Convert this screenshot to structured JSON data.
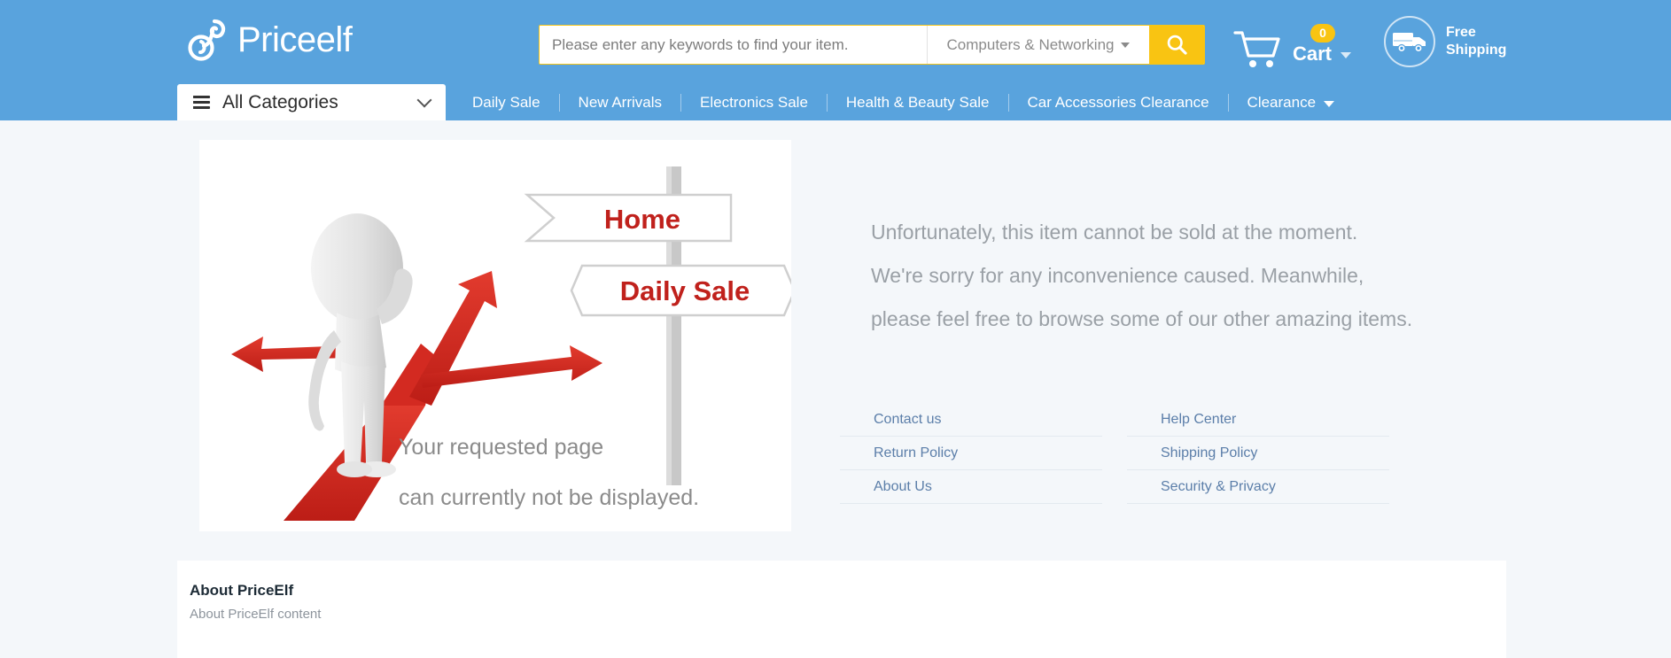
{
  "brand": {
    "name": "Priceelf",
    "logo_icon": "elf-swirl-logo-icon",
    "header_color": "#59a3dd",
    "accent_color": "#f9c412",
    "page_background": "#f4f7fa"
  },
  "search": {
    "placeholder": "Please enter any keywords to find your item.",
    "value": "",
    "category_selected": "Computers & Networking",
    "category_caret_icon": "caret-down-icon",
    "button_icon": "search-icon"
  },
  "cart": {
    "icon": "shopping-cart-icon",
    "badge_count": "0",
    "label": "Cart",
    "caret_icon": "caret-down-icon"
  },
  "shipping": {
    "icon": "delivery-truck-icon",
    "line1": "Free",
    "line2": "Shipping"
  },
  "nav": {
    "all_categories": {
      "label": "All Categories",
      "menu_icon": "list-menu-icon",
      "chevron_icon": "chevron-down-icon"
    },
    "items": [
      {
        "label": "Daily Sale",
        "has_caret": false
      },
      {
        "label": "New Arrivals",
        "has_caret": false
      },
      {
        "label": "Electronics Sale",
        "has_caret": false
      },
      {
        "label": "Health & Beauty Sale",
        "has_caret": false
      },
      {
        "label": "Car Accessories Clearance",
        "has_caret": false
      },
      {
        "label": "Clearance",
        "has_caret": true
      }
    ]
  },
  "error_illustration": {
    "alt": "3d-figure-at-crossroads-illustration",
    "sign_top": "Home",
    "sign_bottom": "Daily Sale",
    "caption_line1": "Your requested page",
    "caption_line2": "can currently not be displayed."
  },
  "message": {
    "line1": "Unfortunately, this item cannot be sold at the moment.",
    "line2": "We're sorry for any inconvenience caused. Meanwhile,",
    "line3": "please feel free to browse some of our other amazing items."
  },
  "help_links": {
    "left_column": [
      "Contact us",
      "Return Policy",
      "About Us"
    ],
    "right_column": [
      "Help Center",
      "Shipping Policy",
      "Security & Privacy"
    ]
  },
  "about": {
    "title": "About PriceElf",
    "content": "About PriceElf content"
  }
}
